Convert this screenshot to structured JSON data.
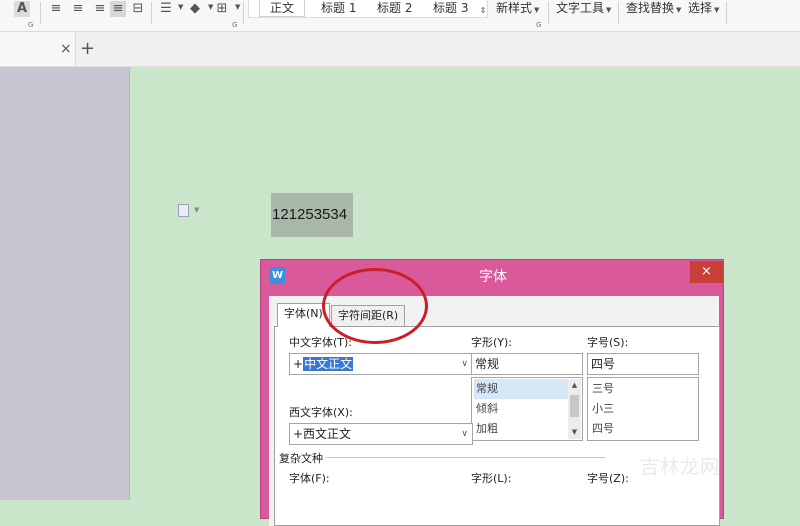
{
  "ribbon": {
    "dialog_launcher": "G",
    "styles": [
      "正文",
      "标题 1",
      "标题 2",
      "标题 3"
    ],
    "new_style": "新样式",
    "text_tools": "文字工具",
    "find_replace": "查找替换",
    "select": "选择",
    "font_color_glyph": "A"
  },
  "tabstrip": {
    "close": "×",
    "add": "+"
  },
  "document": {
    "text": "121253534"
  },
  "dialog": {
    "title": "字体",
    "logo": "W",
    "close": "×",
    "tabs": [
      "字体(N)",
      "字符间距(R)"
    ],
    "chinese_font_label": "中文字体(T):",
    "chinese_font_prefix": "+",
    "chinese_font_value": "中文正文",
    "style_label": "字形(Y):",
    "style_value": "常规",
    "style_options": [
      "常规",
      "倾斜",
      "加粗"
    ],
    "size_label": "字号(S):",
    "size_value": "四号",
    "size_options": [
      "三号",
      "小三",
      "四号"
    ],
    "western_font_label": "西文字体(X):",
    "western_font_value": "+西文正文",
    "complex_group": "复杂文种",
    "complex_font_label": "字体(F):",
    "complex_style_label": "字形(L):",
    "complex_size_label": "字号(Z):"
  },
  "watermark": {
    "text": "吉林龙网"
  },
  "colors": {
    "canvas": "#c9e6ca",
    "dialog_frame": "#d9599b",
    "close_button": "#c9403a",
    "selection": "#3b78d4",
    "annotation": "#c81f28"
  }
}
